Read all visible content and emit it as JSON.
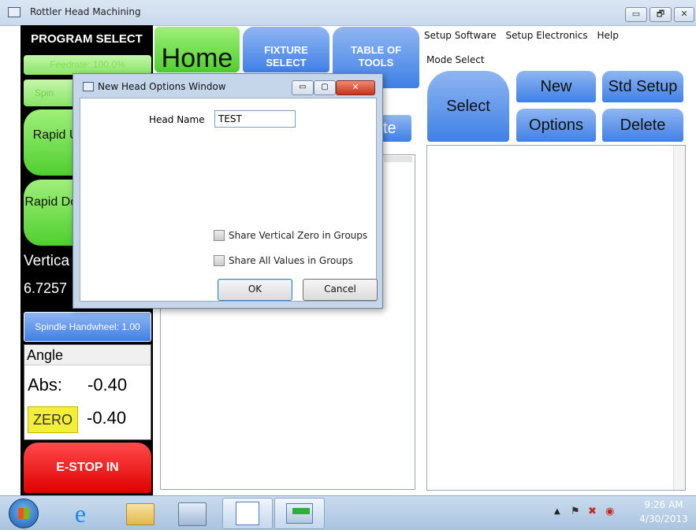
{
  "window": {
    "title": "Rottler Head Machining",
    "controls": [
      "▭",
      "🗗",
      "✕"
    ]
  },
  "left": {
    "program_select": "PROGRAM SELECT",
    "feedrate": "Feedrate: 100.0%",
    "spindle_partial": "Spin",
    "rapid_up": "Rapid Up",
    "rapid_down": "Rapid Down",
    "vertical_label": "Vertica",
    "vertical_value": "6.7257",
    "spindle_handwheel": "Spindle Handwheel: 1.00",
    "angle_label": "Angle",
    "abs_label": "Abs:",
    "abs_value": "-0.40",
    "zero_label": "ZERO",
    "zero_value": "-0.40",
    "estop": "E-STOP IN"
  },
  "top": {
    "home": "Home",
    "fixture_select": "FIXTURE SELECT",
    "table_of_tools": "TABLE OF TOOLS",
    "partial_button": "te"
  },
  "menu": [
    "Setup Software",
    "Setup Electronics",
    "Help"
  ],
  "mode": {
    "title": "Mode Select",
    "select": "Select",
    "new": "New",
    "std_setup": "Std Setup",
    "options": "Options",
    "delete": "Delete"
  },
  "dialog": {
    "title": "New Head Options Window",
    "head_name_label": "Head Name",
    "head_name_value": "TEST",
    "share_vertical": "Share Vertical Zero in Groups",
    "share_all": "Share All Values in Groups",
    "ok": "OK",
    "cancel": "Cancel"
  },
  "taskbar": {
    "time": "9:26 AM",
    "date": "4/30/2013"
  }
}
